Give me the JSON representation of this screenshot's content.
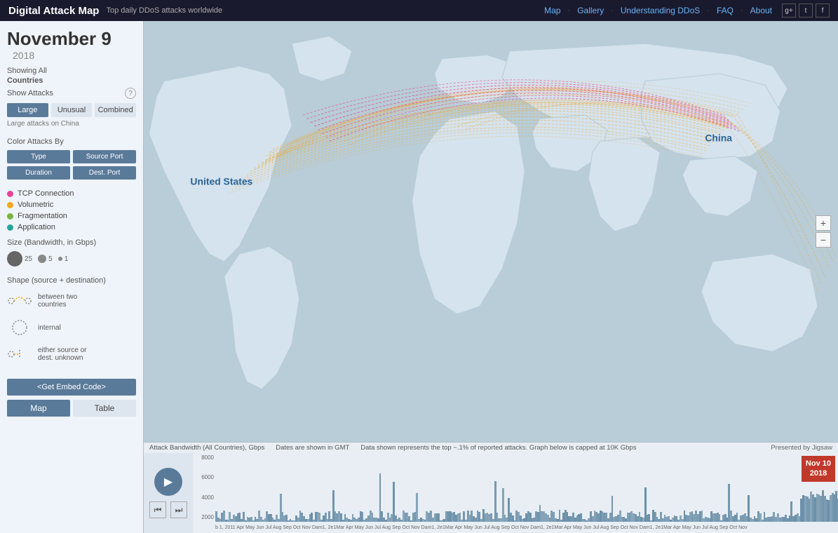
{
  "header": {
    "brand_title": "Digital Attack Map",
    "brand_subtitle": "Top daily DDoS attacks worldwide",
    "nav": {
      "map": "Map",
      "gallery": "Gallery",
      "understanding_ddos": "Understanding DDoS",
      "faq": "FAQ",
      "about": "About"
    },
    "social": [
      "G+",
      "T",
      "F"
    ]
  },
  "sidebar": {
    "date": {
      "month_day": "November 9",
      "year": "2018"
    },
    "showing_label": "Showing All",
    "countries_label": "Countries",
    "show_attacks_label": "Show Attacks",
    "attack_buttons": [
      {
        "label": "Large",
        "active": true
      },
      {
        "label": "Unusual",
        "active": false
      },
      {
        "label": "Combined",
        "active": false
      }
    ],
    "attack_desc": "Large attacks on China",
    "color_attacks_label": "Color Attacks By",
    "color_buttons": [
      {
        "label": "Type"
      },
      {
        "label": "Source Port"
      },
      {
        "label": "Duration"
      },
      {
        "label": "Dest. Port"
      }
    ],
    "legend": [
      {
        "color": "#e84393",
        "label": "TCP Connection"
      },
      {
        "color": "#f5a623",
        "label": "Volumetric"
      },
      {
        "color": "#7cb342",
        "label": "Fragmentation"
      },
      {
        "color": "#26a69a",
        "label": "Application"
      }
    ],
    "size_label": "Size (Bandwidth, in Gbps)",
    "size_values": [
      "25",
      "5",
      "1"
    ],
    "shape_label": "Shape (source + destination)",
    "shapes": [
      {
        "label": "between two\ncountries"
      },
      {
        "label": "internal"
      },
      {
        "label": "either source or\ndest. unknown"
      }
    ],
    "embed_btn": "<Get Embed Code>",
    "bottom_tabs": [
      {
        "label": "Map",
        "active": true
      },
      {
        "label": "Table",
        "active": false
      }
    ]
  },
  "map": {
    "country_labels": [
      {
        "name": "United States",
        "left": "10%",
        "top": "35%"
      },
      {
        "name": "China",
        "left": "71%",
        "top": "38%"
      }
    ]
  },
  "chart": {
    "info_bar": {
      "bandwidth": "Attack Bandwidth (All Countries), Gbps",
      "dates": "Dates are shown in GMT",
      "data_info": "Data shown represents the top ~.1% of reported attacks. Graph below is capped at 10K Gbps",
      "presented": "Presented by Jigsaw"
    },
    "y_labels": [
      "8000",
      "6000",
      "4000",
      "2000"
    ],
    "date_highlight": {
      "line1": "Nov 10",
      "line2": "2018"
    },
    "x_labels": [
      "b 1,",
      "2011Apr May Jun 1ul Aug Sep Oct Nov",
      "Dam1,",
      "2e1Mar Apr May Jun 1ul Aug Sep Oct Nov",
      "Dam1,",
      "2e1Mar Apr May Jun 1ul Aug Sep Oct Nov",
      "Dam1,",
      "2e1Mar Apr May Jun 1ul Aug Sep Oct Nov",
      "Dam1,",
      "2e1Mar Apr May Jun 1ul Aug Sep Oct Nov"
    ]
  }
}
